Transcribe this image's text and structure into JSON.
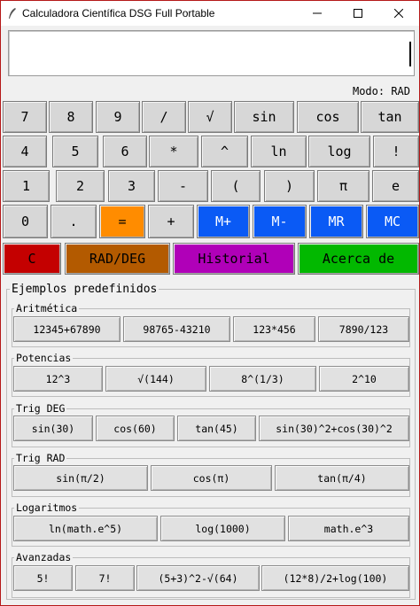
{
  "window": {
    "title": "Calculadora Científica DSG Full Portable"
  },
  "display": {
    "value": ""
  },
  "mode": {
    "text": "Modo: RAD"
  },
  "keypad": {
    "row1": [
      "7",
      "8",
      "9",
      "/",
      "√",
      "sin",
      "cos",
      "tan"
    ],
    "row2": [
      "4",
      "5",
      "6",
      "*",
      "^",
      "ln",
      "log",
      "!"
    ],
    "row3": [
      "1",
      "2",
      "3",
      "-",
      "(",
      ")",
      "π",
      "e"
    ],
    "row4": [
      "0",
      ".",
      "=",
      "+",
      "M+",
      "M-",
      "MR",
      "MC"
    ]
  },
  "actions": [
    "C",
    "RAD/DEG",
    "Historial",
    "Acerca de"
  ],
  "colors": {
    "equals": "#ff8c00",
    "memory": "#0a5af5",
    "clear": "#c40000",
    "rad_deg": "#b35a00",
    "historial": "#b000b8",
    "acerca": "#02b800"
  },
  "examples": {
    "title": "Ejemplos predefinidos",
    "groups": [
      {
        "title": "Aritmética",
        "items": [
          "12345+67890",
          "98765-43210",
          "123*456",
          "7890/123"
        ]
      },
      {
        "title": "Potencias",
        "items": [
          "12^3",
          "√(144)",
          "8^(1/3)",
          "2^10"
        ]
      },
      {
        "title": "Trig DEG",
        "items": [
          "sin(30)",
          "cos(60)",
          "tan(45)",
          "sin(30)^2+cos(30)^2"
        ]
      },
      {
        "title": "Trig RAD",
        "items": [
          "sin(π/2)",
          "cos(π)",
          "tan(π/4)"
        ]
      },
      {
        "title": "Logaritmos",
        "items": [
          "ln(math.e^5)",
          "log(1000)",
          "math.e^3"
        ]
      },
      {
        "title": "Avanzadas",
        "items": [
          "5!",
          "7!",
          "(5+3)^2-√(64)",
          "(12*8)/2+log(100)"
        ]
      }
    ]
  }
}
